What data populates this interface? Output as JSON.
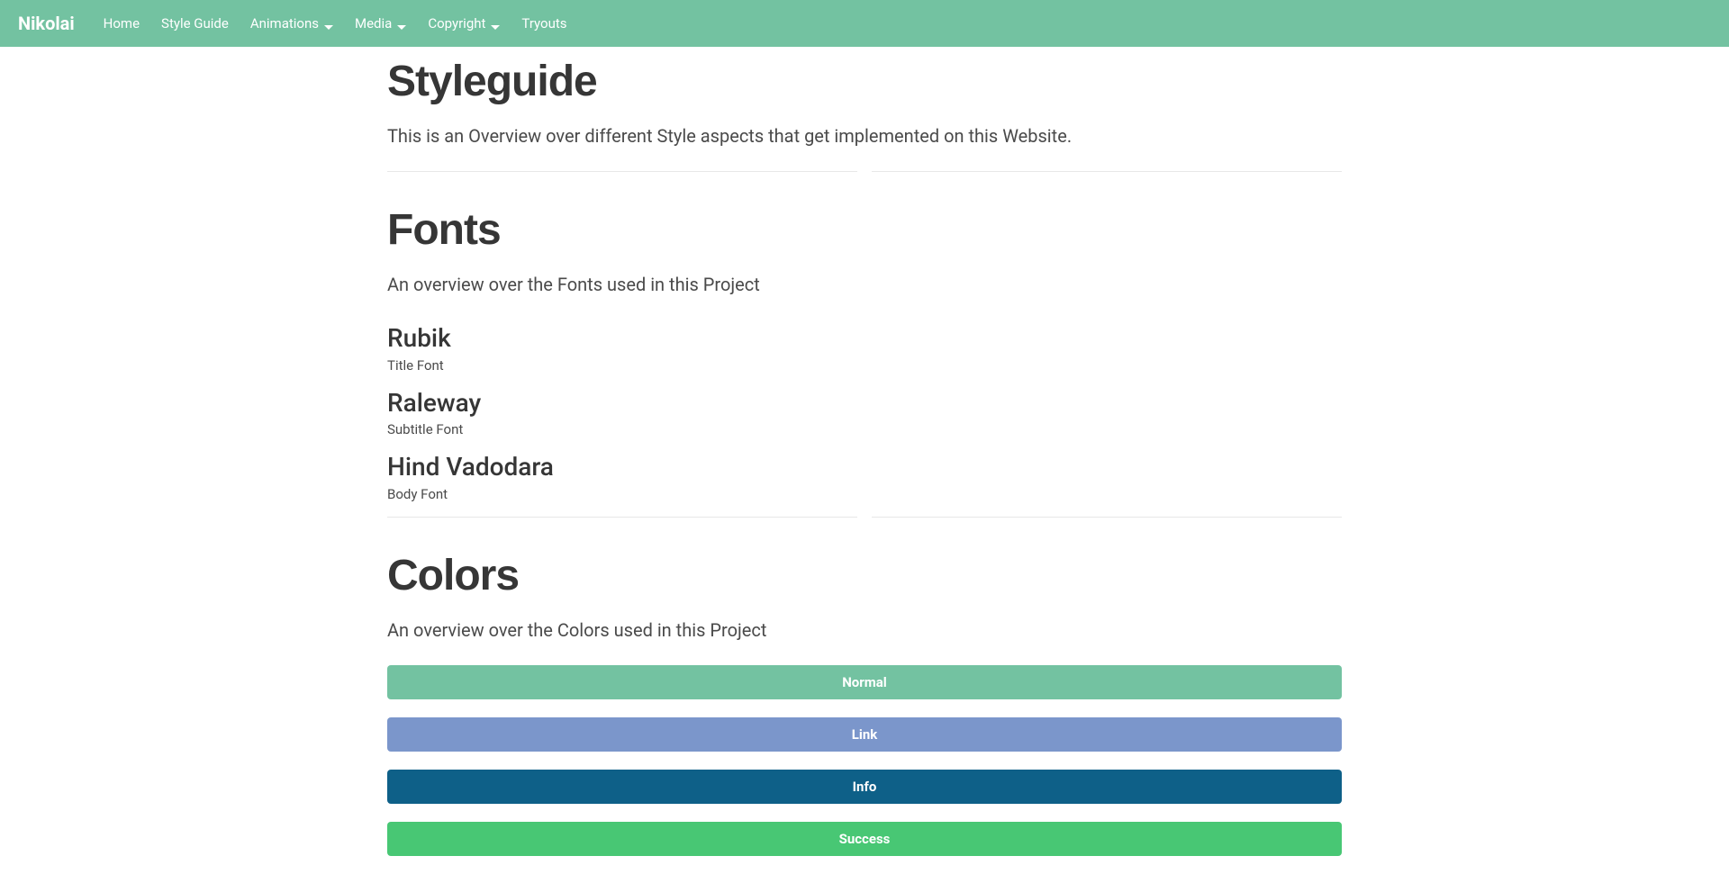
{
  "navbar": {
    "brand": "Nikolai",
    "items": [
      {
        "label": "Home",
        "hasDropdown": false
      },
      {
        "label": "Style Guide",
        "hasDropdown": false
      },
      {
        "label": "Animations",
        "hasDropdown": true
      },
      {
        "label": "Media",
        "hasDropdown": true
      },
      {
        "label": "Copyright",
        "hasDropdown": true
      },
      {
        "label": "Tryouts",
        "hasDropdown": false
      }
    ]
  },
  "styleguide": {
    "title": "Styleguide",
    "subtitle": "This is an Overview over different Style aspects that get implemented on this Website."
  },
  "fonts": {
    "title": "Fonts",
    "subtitle": "An overview over the Fonts used in this Project",
    "items": [
      {
        "name": "Rubik",
        "desc": "Title Font"
      },
      {
        "name": "Raleway",
        "desc": "Subtitle Font"
      },
      {
        "name": "Hind Vadodara",
        "desc": "Body Font"
      }
    ]
  },
  "colors": {
    "title": "Colors",
    "subtitle": "An overview over the Colors used in this Project",
    "items": [
      {
        "label": "Normal",
        "hex": "#73c2a1"
      },
      {
        "label": "Link",
        "hex": "#7b96cb"
      },
      {
        "label": "Info",
        "hex": "#0e6088"
      },
      {
        "label": "Success",
        "hex": "#48c774"
      }
    ]
  }
}
